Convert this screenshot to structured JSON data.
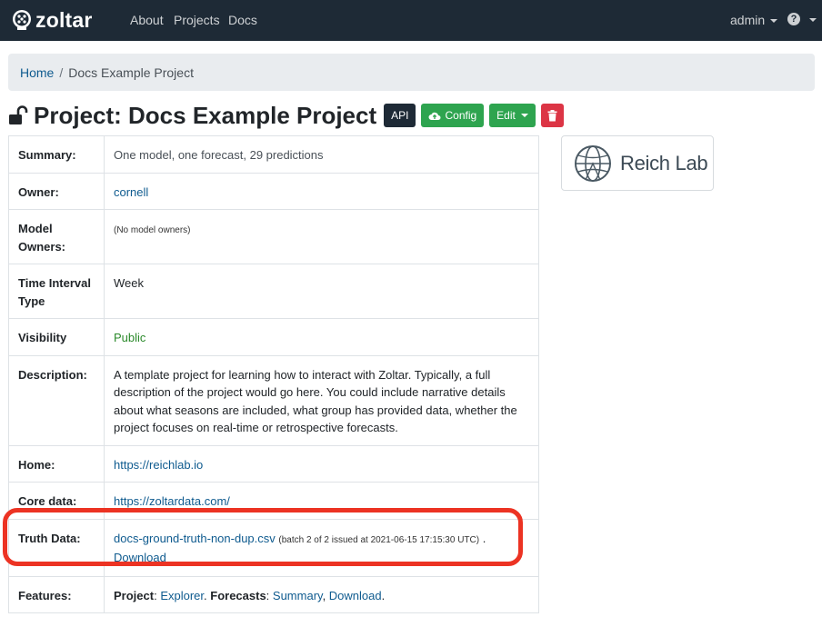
{
  "navbar": {
    "brand": "zoltar",
    "links": [
      "About",
      "Projects",
      "Docs"
    ],
    "user": "admin",
    "help_glyph": "?"
  },
  "breadcrumb": {
    "home": "Home",
    "separator": "/",
    "current": "Docs Example Project"
  },
  "title": {
    "text": "Project: Docs Example Project",
    "buttons": {
      "api": "API",
      "config": "Config",
      "edit": "Edit"
    }
  },
  "table": {
    "summary": {
      "label": "Summary:",
      "value": "One model, one forecast, 29 predictions"
    },
    "owner": {
      "label": "Owner:",
      "value": "cornell"
    },
    "model_owners": {
      "label": "Model Owners:",
      "value": "(No model owners)"
    },
    "time_interval": {
      "label": "Time Interval Type",
      "value": "Week"
    },
    "visibility": {
      "label": "Visibility",
      "value": "Public"
    },
    "description": {
      "label": "Description:",
      "value": "A template project for learning how to interact with Zoltar. Typically, a full description of the project would go here. You could include narrative details about what seasons are included, what group has provided data, whether the project focuses on real-time or retrospective forecasts."
    },
    "home": {
      "label": "Home:",
      "value": "https://reichlab.io"
    },
    "core_data": {
      "label": "Core data:",
      "value": "https://zoltardata.com/"
    },
    "truth_data": {
      "label": "Truth Data:",
      "file": "docs-ground-truth-non-dup.csv",
      "batch": "(batch 2 of 2 issued at 2021-06-15 17:15:30 UTC)",
      "dot": ".",
      "download": "Download"
    },
    "features": {
      "label": "Features:",
      "project_label": "Project",
      "colon1": ": ",
      "explorer": "Explorer",
      "dot1": ". ",
      "forecasts_label": "Forecasts",
      "colon2": ": ",
      "summary": "Summary",
      "comma": ", ",
      "download": "Download",
      "dot2": "."
    }
  },
  "logo_card": {
    "text": "Reich Lab"
  },
  "icons": [
    "zoltar-logo-icon",
    "lock-open-icon",
    "cloud-upload-icon",
    "trash-icon",
    "question-circle-icon",
    "globe-icon"
  ],
  "colors": {
    "navbar": "#1e2a36",
    "success": "#2ea44f",
    "danger": "#dc3545",
    "link": "#0f5b8f",
    "highlight": "#ec3323",
    "public": "#2b8a2b"
  }
}
